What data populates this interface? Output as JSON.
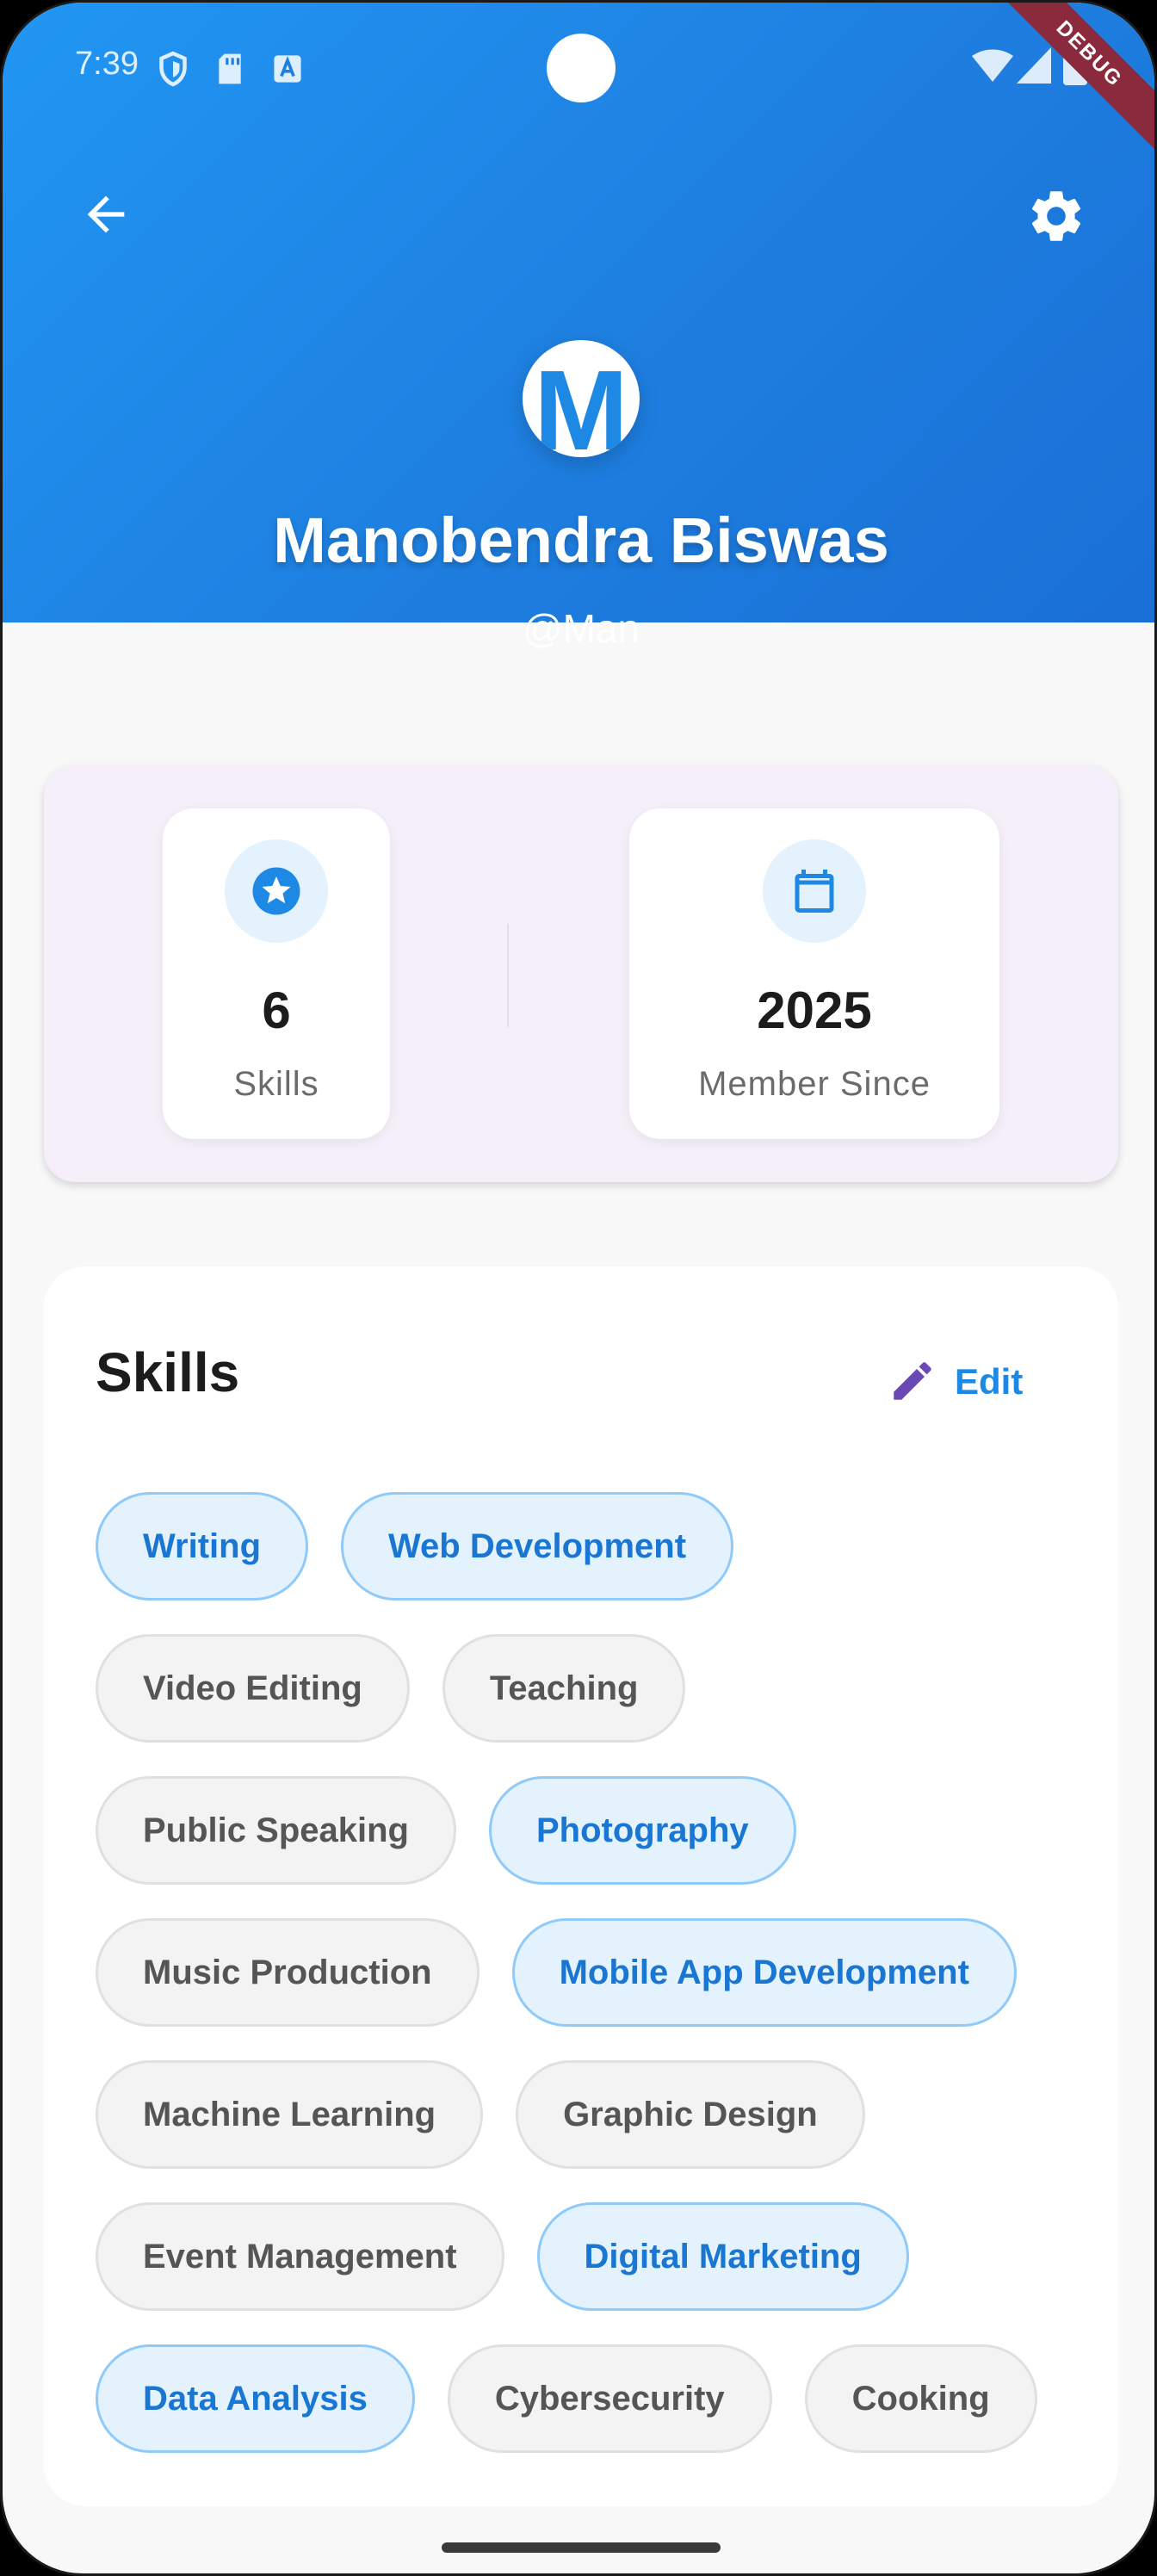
{
  "status_bar": {
    "time": "7:39",
    "left_icons": [
      "shield-icon",
      "sd-card-icon",
      "a-badge-icon"
    ],
    "right_icons": [
      "wifi-icon",
      "signal-icon",
      "battery-icon"
    ],
    "debug_label": "DEBUG"
  },
  "header": {
    "back_icon": "arrow-left-icon",
    "settings_icon": "gear-icon",
    "avatar_letter": "M",
    "name": "Manobendra Biswas",
    "handle": "@Man",
    "gradient_colors": [
      "#2196f3",
      "#1a6fd6"
    ]
  },
  "stats": {
    "items": [
      {
        "icon": "star-badge-icon",
        "value": "6",
        "label": "Skills"
      },
      {
        "icon": "calendar-icon",
        "value": "2025",
        "label": "Member Since"
      }
    ]
  },
  "skills": {
    "title": "Skills",
    "edit_label": "Edit",
    "chips": [
      {
        "label": "Writing",
        "selected": true
      },
      {
        "label": "Web Development",
        "selected": true
      },
      {
        "label": "Video Editing",
        "selected": false
      },
      {
        "label": "Teaching",
        "selected": false
      },
      {
        "label": "Public Speaking",
        "selected": false
      },
      {
        "label": "Photography",
        "selected": true
      },
      {
        "label": "Music Production",
        "selected": false
      },
      {
        "label": "Mobile App Development",
        "selected": true
      },
      {
        "label": "Machine Learning",
        "selected": false
      },
      {
        "label": "Graphic Design",
        "selected": false
      },
      {
        "label": "Event Management",
        "selected": false
      },
      {
        "label": "Digital Marketing",
        "selected": true
      },
      {
        "label": "Data Analysis",
        "selected": true
      },
      {
        "label": "Cybersecurity",
        "selected": false
      },
      {
        "label": "Cooking",
        "selected": false
      }
    ]
  },
  "colors": {
    "accent": "#1e88e5",
    "chip_selected_bg": "#e3f2fd",
    "chip_selected_text": "#1976d2",
    "chip_unselected_bg": "#f3f3f3",
    "edit_icon": "#6a48b6"
  }
}
